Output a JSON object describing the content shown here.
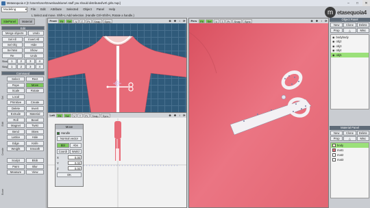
{
  "window": {
    "title": "Metasequoia 4 [C:\\Users\\User\\Downloads\\ame\\ stuff you should distributed\\vrt\\ girls.mqo]",
    "min": "–",
    "max": "□",
    "close": "✕"
  },
  "mode": {
    "value": "Modeling",
    "arrow": "▾"
  },
  "menu": [
    "File",
    "Edit",
    "Attribute",
    "Selected",
    "Object",
    "Panel",
    "Help"
  ],
  "status": "L Select and move. Shift+L:Add selection. (Handle Ctrl+Shift+L:Rotate a handle.)",
  "logo": {
    "mark": "m",
    "word": "etasequoia4"
  },
  "left": {
    "tabs": [
      {
        "label": "SitePanel",
        "on": true
      },
      {
        "label": "Material",
        "on": false
      }
    ],
    "edit_title": "Edit",
    "edit_buttons": [
      "Merge objects",
      "Undo",
      "Sel All",
      "Invert All",
      "Sel Obj",
      "Hide",
      "Sel Mat",
      "Show",
      "Re",
      "Undo"
    ],
    "step_label": "Stock",
    "step": [
      "1",
      "2",
      "3",
      "4"
    ],
    "step2_label": "Step",
    "step2": [
      "1",
      "2",
      "3",
      "4"
    ],
    "cmd_title": "Command",
    "cmd_labels": [
      "Sel",
      "Edit",
      "Create",
      "Bone"
    ],
    "commands": [
      "Select",
      "Rect",
      "Rope",
      "Move",
      "Scale",
      "Rotate",
      "Local",
      "",
      "Primitive",
      "Create",
      "Delete",
      "Invert",
      "Extrude",
      "Material",
      "Roll",
      "Bevel",
      "Magnet",
      "Twist",
      "Bend",
      "Skew",
      "Lattice",
      "Hole",
      "Edge",
      "Knife",
      "Weight",
      "Smooth",
      "",
      "",
      "Sculpt",
      "Blob",
      "Paint",
      "Blur",
      "Measure",
      "View"
    ]
  },
  "vp_top": {
    "label": "Front",
    "buttons": [
      "Fit",
      "Sel",
      "V",
      "T",
      "Pr",
      "Snap",
      "Sync"
    ],
    "zoom": "⊕",
    "tools": [
      "✥",
      "↕",
      "⟳"
    ]
  },
  "vp_persp": {
    "label": "Pers",
    "buttons": [
      "Fit",
      "Sel",
      "V",
      "T",
      "Pr",
      "Snap",
      "Sync"
    ],
    "zoom": "⊕",
    "tools": [
      "✥",
      "↕",
      "⟳"
    ]
  },
  "vp_bottom": {
    "label": "Left",
    "buttons": [
      "Fit",
      "Sel",
      "V",
      "T",
      "Pr",
      "Snap",
      "Sync"
    ],
    "zoom": "⊕",
    "tools": [
      "✥",
      "↕",
      "⟳"
    ]
  },
  "move_dialog": {
    "title": "Move",
    "handle": "Handle",
    "normal": "Normal vector",
    "tabs": [
      "Bbl",
      "Abs"
    ],
    "coords": [
      "Coordi",
      "World"
    ],
    "fields": [
      {
        "axis": "X",
        "value": "0.00"
      },
      {
        "axis": "Y",
        "value": "0.00"
      },
      {
        "axis": "Z",
        "value": "0.00"
      }
    ],
    "ok": "OK"
  },
  "objects": {
    "title": "Object Panel",
    "buttons": [
      "New",
      "Clone",
      "Delete",
      "Prop",
      "△",
      "Misc"
    ],
    "items": [
      {
        "name": "bodybody",
        "on": false
      },
      {
        "name": "obj2",
        "on": false
      },
      {
        "name": "obj3",
        "on": false
      },
      {
        "name": "obj4",
        "on": false
      },
      {
        "name": "obj5",
        "on": true
      }
    ]
  },
  "materials": {
    "title": "Material Panel",
    "buttons": [
      "New",
      "Clone",
      "Delete",
      "Prop",
      "△",
      "Misc"
    ],
    "items": [
      {
        "name": "body",
        "color": "#f6f1d2",
        "on": true
      },
      {
        "name": "mat1",
        "color": "#e76b78",
        "on": false
      },
      {
        "name": "mat2",
        "color": "#ffffff",
        "on": false
      },
      {
        "name": "mat3",
        "color": "#ffffff",
        "on": false
      }
    ]
  },
  "colors": {
    "grid_bg": "#2f5a7a",
    "model": "#e76b78",
    "accent": "#7cc85a"
  }
}
